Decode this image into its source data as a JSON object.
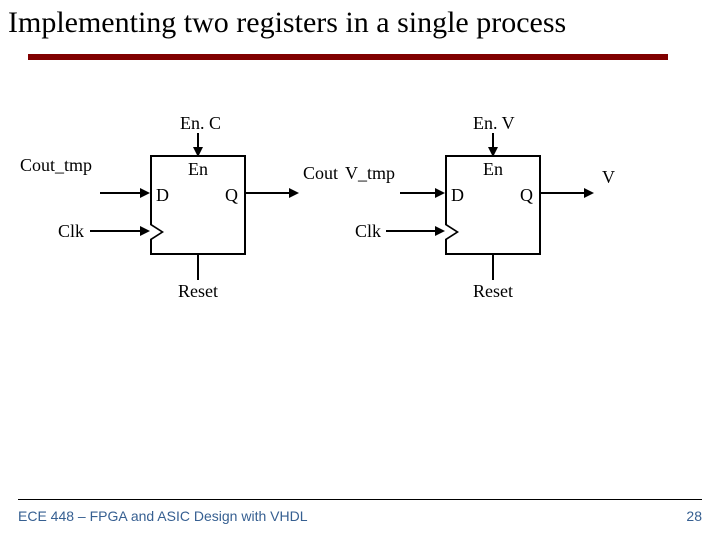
{
  "title": "Implementing two registers in a single process",
  "register1": {
    "top_enable": "En. C",
    "inner_en": "En",
    "d": "D",
    "q": "Q",
    "input_net": "Cout_tmp",
    "output_net": "Cout",
    "clk": "Clk",
    "reset": "Reset"
  },
  "register2": {
    "top_enable": "En. V",
    "inner_en": "En",
    "d": "D",
    "q": "Q",
    "input_net": "V_tmp",
    "output_net": "V",
    "clk": "Clk",
    "reset": "Reset"
  },
  "footer": {
    "course": "ECE 448 – FPGA and ASIC Design with VHDL",
    "page": "28"
  }
}
